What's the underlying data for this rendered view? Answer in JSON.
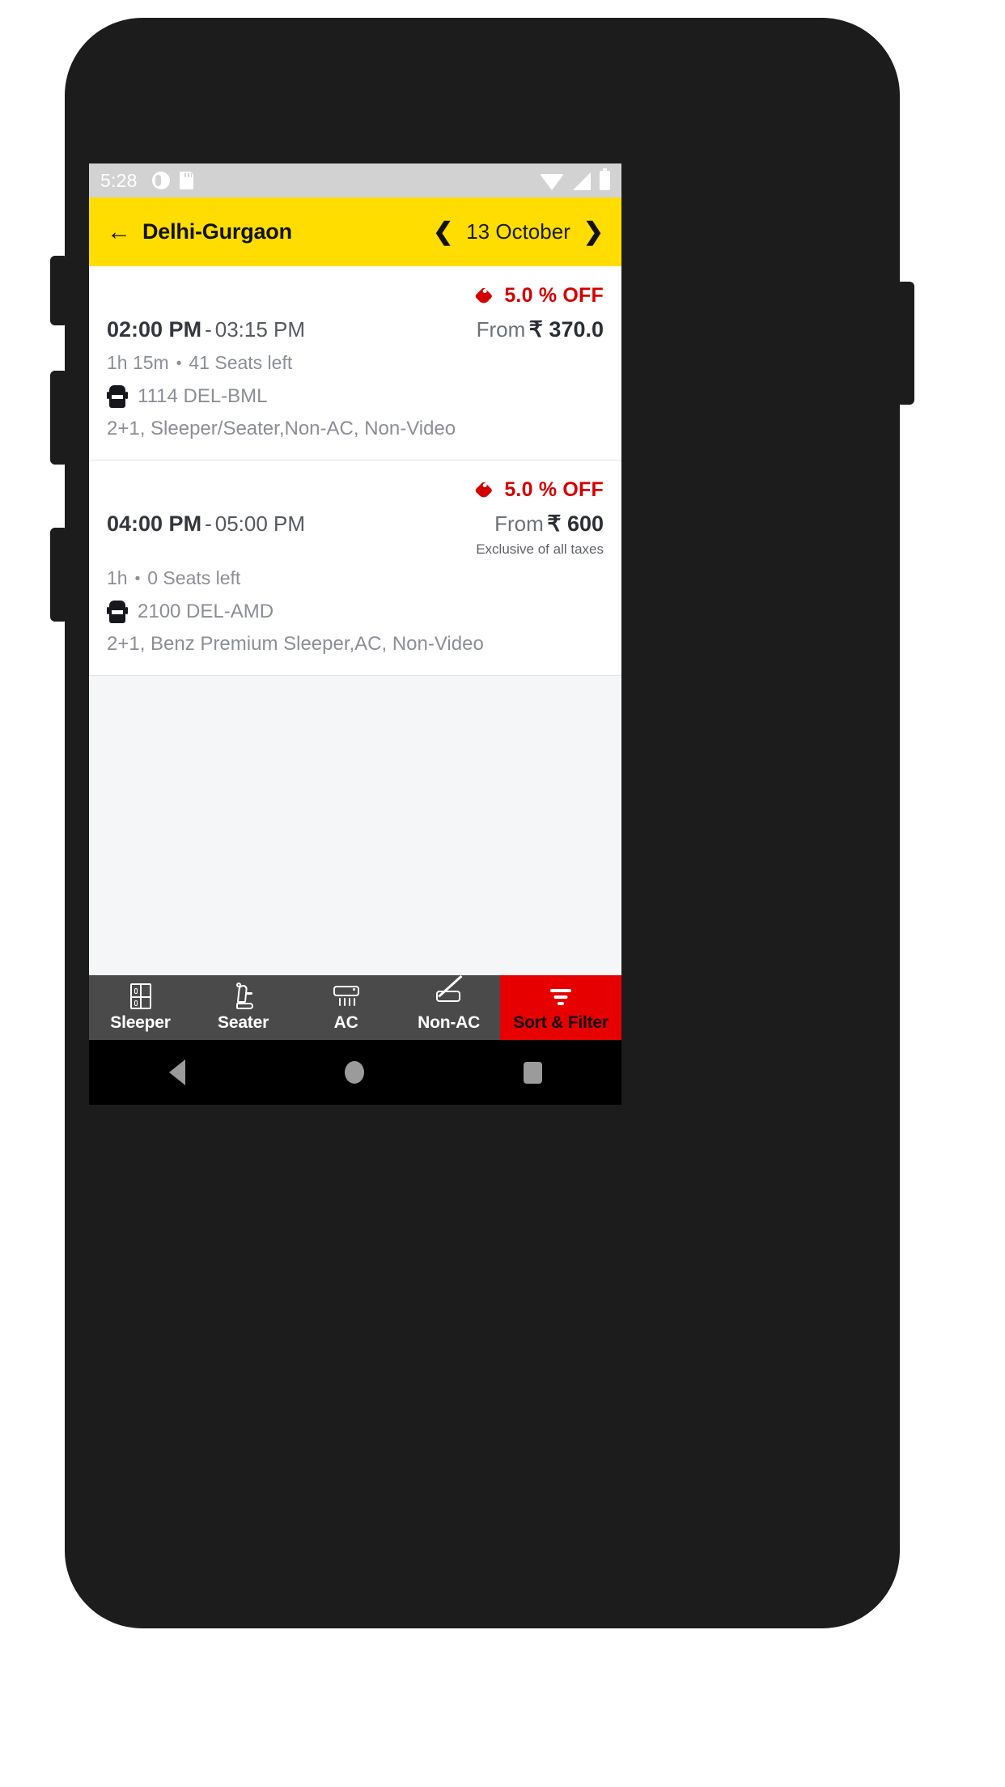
{
  "status_bar": {
    "time": "5:28",
    "left_icons": [
      "account-circle-icon",
      "sd-card-icon"
    ],
    "right_icons": [
      "wifi-icon",
      "signal-icon",
      "battery-icon"
    ]
  },
  "app_bar": {
    "back_icon": "arrow-left-icon",
    "title": "Delhi-Gurgaon",
    "prev_icon": "chevron-left-icon",
    "date": "13 October",
    "next_icon": "chevron-right-icon",
    "background": "#ffdd00"
  },
  "buses": [
    {
      "offer_icon": "price-tag-icon",
      "offer": "5.0 % OFF",
      "departure": "02:00 PM",
      "separator": "-",
      "arrival": "03:15 PM",
      "price_prefix": "From",
      "price": "₹ 370.0",
      "price_note": "",
      "duration": "1h 15m",
      "dot": "•",
      "seats": "41 Seats left",
      "bus_icon": "bus-icon",
      "bus_number": "1114 DEL-BML",
      "description": "2+1, Sleeper/Seater,Non-AC, Non-Video"
    },
    {
      "offer_icon": "price-tag-icon",
      "offer": "5.0 % OFF",
      "departure": "04:00 PM",
      "separator": "-",
      "arrival": "05:00 PM",
      "price_prefix": "From",
      "price": "₹ 600",
      "price_note": "Exclusive of all taxes",
      "duration": "1h",
      "dot": "•",
      "seats": "0 Seats left",
      "bus_icon": "bus-icon",
      "bus_number": "2100 DEL-AMD",
      "description": "2+1, Benz Premium Sleeper,AC, Non-Video"
    }
  ],
  "filter_bar": {
    "background": "#4a4a4a",
    "accent": "#e60000",
    "items": [
      {
        "icon": "sleeper-berth-icon",
        "label": "Sleeper"
      },
      {
        "icon": "seat-icon",
        "label": "Seater"
      },
      {
        "icon": "air-conditioner-icon",
        "label": "AC"
      },
      {
        "icon": "air-conditioner-off-icon",
        "label": "Non-AC"
      },
      {
        "icon": "filter-funnel-icon",
        "label": "Sort & Filter"
      }
    ]
  },
  "nav_bar": {
    "back_icon": "android-back-icon",
    "home_icon": "android-home-icon",
    "recents_icon": "android-recents-icon"
  },
  "colors": {
    "brand_yellow": "#ffdd00",
    "offer_red": "#d40000",
    "sort_red": "#e60000"
  }
}
